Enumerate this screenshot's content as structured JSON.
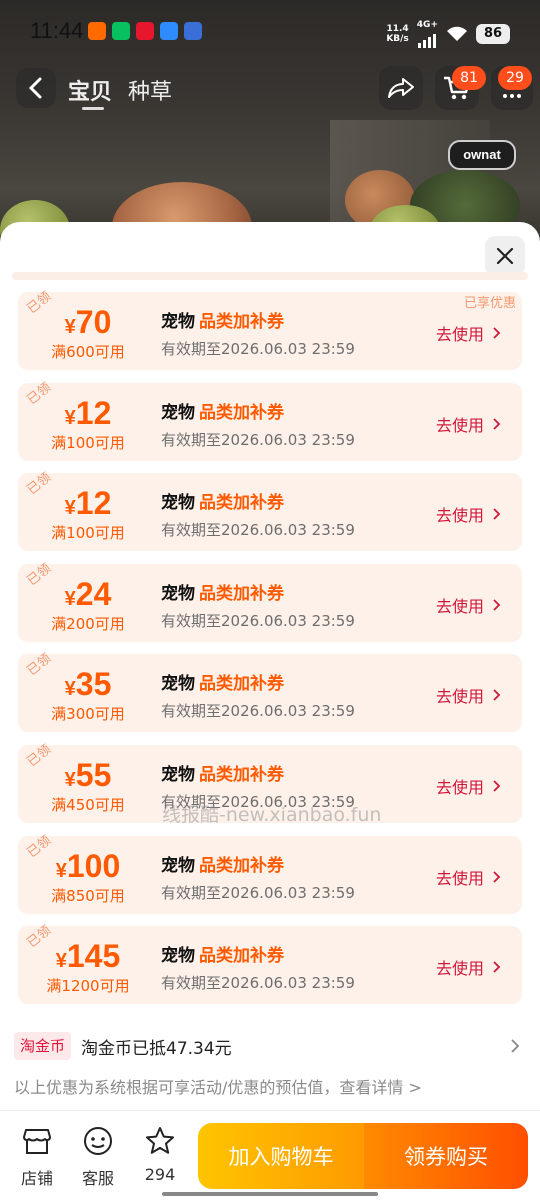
{
  "status_bar": {
    "time": "11:44",
    "net_speed_value": "11.4",
    "net_speed_unit": "KB/s",
    "network": "4G+",
    "battery": "86",
    "apps": [
      {
        "icon": "taobao-icon",
        "color": "#ff6a00"
      },
      {
        "icon": "wechat-icon",
        "color": "#07c160"
      },
      {
        "icon": "weibo-icon",
        "color": "#e6162d"
      },
      {
        "icon": "message-icon",
        "color": "#2e8cff"
      },
      {
        "icon": "screen-icon",
        "color": "#3a6fd8"
      }
    ]
  },
  "nav": {
    "tabs": [
      "宝贝",
      "种草"
    ],
    "active_tab": "宝贝",
    "share_icon": "share-icon",
    "cart_badge": "81",
    "message_badge": "29"
  },
  "brand_logo": "ownat",
  "coupon_sheet": {
    "close_icon": "close-icon",
    "enjoyed_label": "已享优惠",
    "coupons": [
      {
        "claimed": "已领",
        "currency": "¥",
        "amount": "70",
        "condition": "满600可用",
        "type": "宠物",
        "category": "品类加补券",
        "validity": "有效期至2026.06.03 23:59",
        "action": "去使用"
      },
      {
        "claimed": "已领",
        "currency": "¥",
        "amount": "12",
        "condition": "满100可用",
        "type": "宠物",
        "category": "品类加补券",
        "validity": "有效期至2026.06.03 23:59",
        "action": "去使用"
      },
      {
        "claimed": "已领",
        "currency": "¥",
        "amount": "12",
        "condition": "满100可用",
        "type": "宠物",
        "category": "品类加补券",
        "validity": "有效期至2026.06.03 23:59",
        "action": "去使用"
      },
      {
        "claimed": "已领",
        "currency": "¥",
        "amount": "24",
        "condition": "满200可用",
        "type": "宠物",
        "category": "品类加补券",
        "validity": "有效期至2026.06.03 23:59",
        "action": "去使用"
      },
      {
        "claimed": "已领",
        "currency": "¥",
        "amount": "35",
        "condition": "满300可用",
        "type": "宠物",
        "category": "品类加补券",
        "validity": "有效期至2026.06.03 23:59",
        "action": "去使用"
      },
      {
        "claimed": "已领",
        "currency": "¥",
        "amount": "55",
        "condition": "满450可用",
        "type": "宠物",
        "category": "品类加补券",
        "validity": "有效期至2026.06.03 23:59",
        "action": "去使用"
      },
      {
        "claimed": "已领",
        "currency": "¥",
        "amount": "100",
        "condition": "满850可用",
        "type": "宠物",
        "category": "品类加补券",
        "validity": "有效期至2026.06.03 23:59",
        "action": "去使用"
      },
      {
        "claimed": "已领",
        "currency": "¥",
        "amount": "145",
        "condition": "满1200可用",
        "type": "宠物",
        "category": "品类加补券",
        "validity": "有效期至2026.06.03 23:59",
        "action": "去使用"
      }
    ],
    "watermark": "线报酷-new.xianbao.fun",
    "coin_tag": "淘金币",
    "coin_text": "淘金币已抵47.34元",
    "note": "以上优惠为系统根据可享活动/优惠的预估值，查看详情 >"
  },
  "bottom_bar": {
    "store_label": "店铺",
    "service_label": "客服",
    "favorite_count": "294",
    "add_to_cart": "加入购物车",
    "buy_with_coupon": "领券购买"
  },
  "colors": {
    "accent_orange": "#ff5a00",
    "use_red": "#d2183a",
    "coupon_bg": "#fdf1ea",
    "cart_gradient": [
      "#ffc400",
      "#ff9a00"
    ],
    "buy_gradient": [
      "#ff8a00",
      "#ff4f00"
    ]
  }
}
